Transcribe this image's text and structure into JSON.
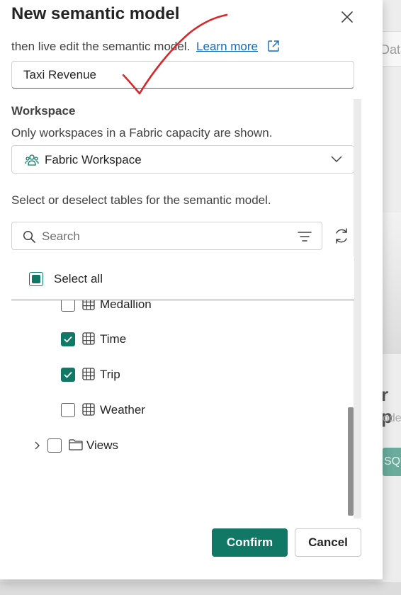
{
  "dialog": {
    "title": "New semantic model",
    "description_partial": "then live edit the semantic model.",
    "learn_more": "Learn more",
    "name_value": "Taxi Revenue",
    "workspace_label": "Workspace",
    "workspace_hint": "Only workspaces in a Fabric capacity are shown.",
    "workspace_value": "Fabric Workspace",
    "tables_hint": "Select or deselect tables for the semantic model.",
    "search_placeholder": "Search",
    "select_all_label": "Select all",
    "tree_items": [
      {
        "label": "Medallion",
        "checked": false,
        "icon": "table-icon",
        "partially_visible": true
      },
      {
        "label": "Time",
        "checked": true,
        "icon": "table-icon"
      },
      {
        "label": "Trip",
        "checked": true,
        "icon": "table-icon"
      },
      {
        "label": "Weather",
        "checked": false,
        "icon": "table-icon"
      },
      {
        "label": "Views",
        "checked": false,
        "icon": "folder-icon",
        "expandable": true
      }
    ],
    "confirm_label": "Confirm",
    "cancel_label": "Cancel"
  },
  "background": {
    "card_text_partial": "Data",
    "heading_partial": "r p",
    "subtext_partial": "ode",
    "button_partial": "SQL"
  },
  "colors": {
    "accent": "#117865",
    "link": "#0f6cbd",
    "annotation_checkmark": "#d9262b"
  }
}
